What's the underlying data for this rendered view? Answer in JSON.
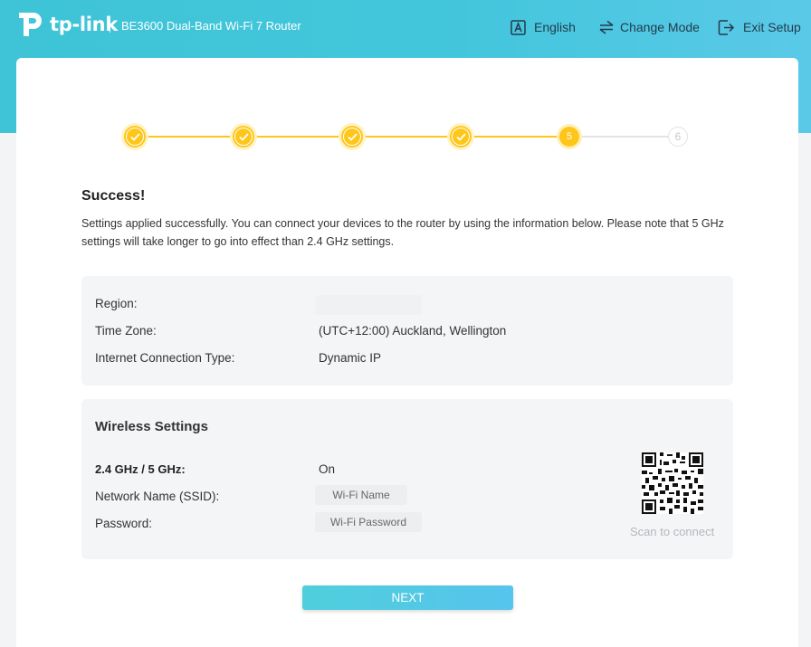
{
  "header": {
    "logo_text": "tp-link",
    "product_name": "BE3600 Dual-Band Wi-Fi 7 Router",
    "language_label": "English",
    "change_mode_label": "Change Mode",
    "exit_setup_label": "Exit Setup"
  },
  "stepper": {
    "current_step_label": "5",
    "next_step_label": "6",
    "completed_steps": 4,
    "total_steps": 6
  },
  "content": {
    "title": "Success!",
    "description": "Settings applied successfully. You can connect your devices to the router by using the information below. Please note that 5 GHz settings will take longer to go into effect than 2.4 GHz settings."
  },
  "summary": {
    "region_label": "Region:",
    "region_value": "",
    "timezone_label": "Time Zone:",
    "timezone_value": "(UTC+12:00) Auckland, Wellington",
    "connection_label": "Internet Connection Type:",
    "connection_value": "Dynamic IP"
  },
  "wireless": {
    "title": "Wireless Settings",
    "band_label": "2.4 GHz / 5 GHz:",
    "band_value": "On",
    "ssid_label": "Network Name (SSID):",
    "ssid_value": "Wi-Fi Name",
    "password_label": "Password:",
    "password_value": "Wi-Fi Password",
    "scan_label": "Scan to connect"
  },
  "actions": {
    "next_label": "NEXT"
  },
  "colors": {
    "brand": "#42c6dc",
    "step_accent": "#ffc61a"
  }
}
